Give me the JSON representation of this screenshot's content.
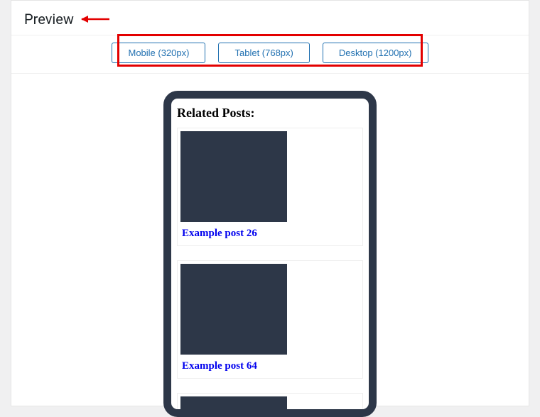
{
  "header": {
    "title": "Preview"
  },
  "breakpoints": {
    "mobile": "Mobile (320px)",
    "tablet": "Tablet (768px)",
    "desktop": "Desktop (1200px)"
  },
  "preview": {
    "heading": "Related Posts:",
    "posts": [
      {
        "title": "Example post 26"
      },
      {
        "title": "Example post 64"
      }
    ],
    "annotation_arrow_color": "#e30000",
    "annotation_box_color": "#e30000"
  }
}
